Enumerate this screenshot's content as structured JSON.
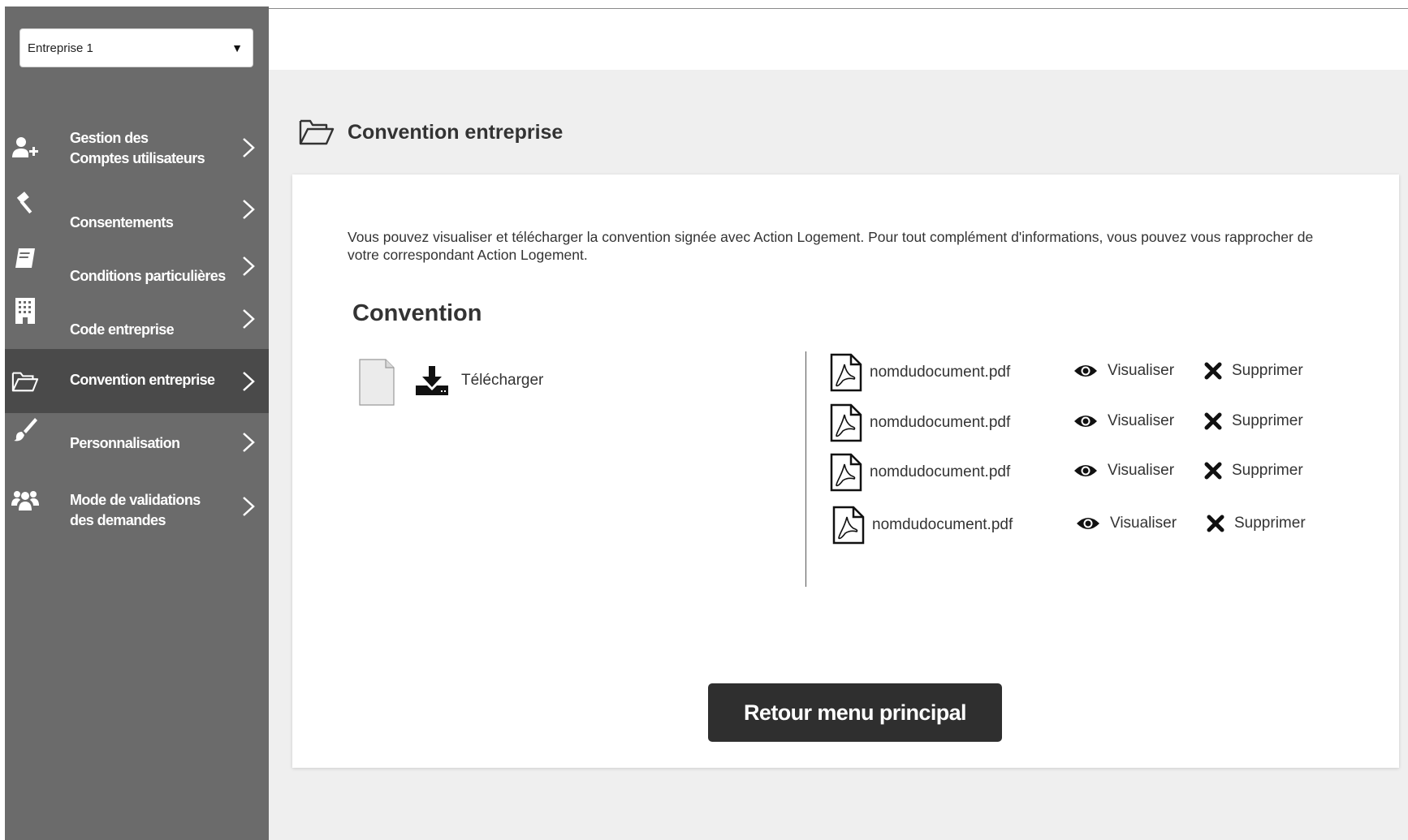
{
  "sidebar": {
    "company_select": {
      "value": "Entreprise 1"
    },
    "items": [
      {
        "label_line1": "Gestion des",
        "label_line2": "Comptes utilisateurs",
        "icon": "user-plus-icon"
      },
      {
        "label": "Consentements",
        "icon": "gavel-icon"
      },
      {
        "label": "Conditions particulières",
        "icon": "book-icon"
      },
      {
        "label": "Code entreprise",
        "icon": "building-icon"
      },
      {
        "label": "Convention  entreprise",
        "icon": "folder-open-icon",
        "active": true
      },
      {
        "label": "Personnalisation",
        "icon": "brush-icon"
      },
      {
        "label_line1": "Mode de validations",
        "label_line2": "des demandes",
        "icon": "users-icon"
      }
    ]
  },
  "main": {
    "title": "Convention entreprise",
    "intro": "Vous pouvez visualiser et télécharger la convention signée avec Action Logement. Pour tout complément d'informations, vous pouvez vous rapprocher de votre correspondant Action Logement.",
    "section_title": "Convention",
    "download_label": "Télécharger",
    "documents": [
      {
        "name": "nomdudocument.pdf",
        "view_label": "Visualiser",
        "delete_label": "Supprimer"
      },
      {
        "name": "nomdudocument.pdf",
        "view_label": "Visualiser",
        "delete_label": "Supprimer"
      },
      {
        "name": "nomdudocument.pdf",
        "view_label": "Visualiser",
        "delete_label": "Supprimer"
      },
      {
        "name": "nomdudocument.pdf",
        "view_label": "Visualiser",
        "delete_label": "Supprimer"
      }
    ],
    "back_button": "Retour menu principal"
  },
  "colors": {
    "sidebar_bg": "#6b6b6b",
    "sidebar_active_bg": "#4a4a4a",
    "main_bg": "#efefef",
    "button_bg": "#2f2f2f"
  }
}
